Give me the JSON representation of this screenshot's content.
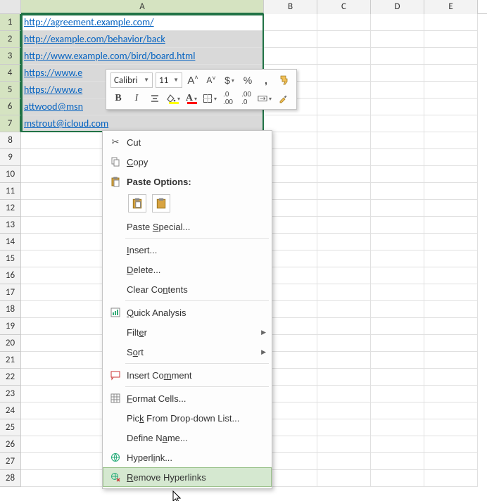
{
  "columns": [
    "A",
    "B",
    "C",
    "D",
    "E"
  ],
  "total_rows": 28,
  "selected_rows": [
    1,
    2,
    3,
    4,
    5,
    6,
    7
  ],
  "cells": {
    "A1": "http://agreement.example.com/",
    "A2": "http://example.com/behavior/back",
    "A3": "http://www.example.com/bird/board.html",
    "A4": "https://www.e",
    "A5": "https://www.e",
    "A6": "attwood@msn",
    "A7": "mstrout@icloud.com"
  },
  "mini_toolbar": {
    "font": "Calibri",
    "size": "11",
    "btn_grow_font": "A",
    "btn_shrink_font": "A",
    "btn_accounting": "$",
    "btn_percent": "%",
    "btn_comma": ",",
    "btn_bold": "B",
    "btn_italic": "I"
  },
  "context_menu": {
    "cut": "Cut",
    "copy": "Copy",
    "paste_options": "Paste Options:",
    "paste_special": "Paste Special...",
    "insert": "Insert...",
    "delete": "Delete...",
    "clear_contents": "Clear Contents",
    "quick_analysis": "Quick Analysis",
    "filter": "Filter",
    "sort": "Sort",
    "insert_comment": "Insert Comment",
    "format_cells": "Format Cells...",
    "pick_list": "Pick From Drop-down List...",
    "define_name": "Define Name...",
    "hyperlink": "Hyperlink...",
    "remove_hyperlinks": "Remove Hyperlinks"
  }
}
